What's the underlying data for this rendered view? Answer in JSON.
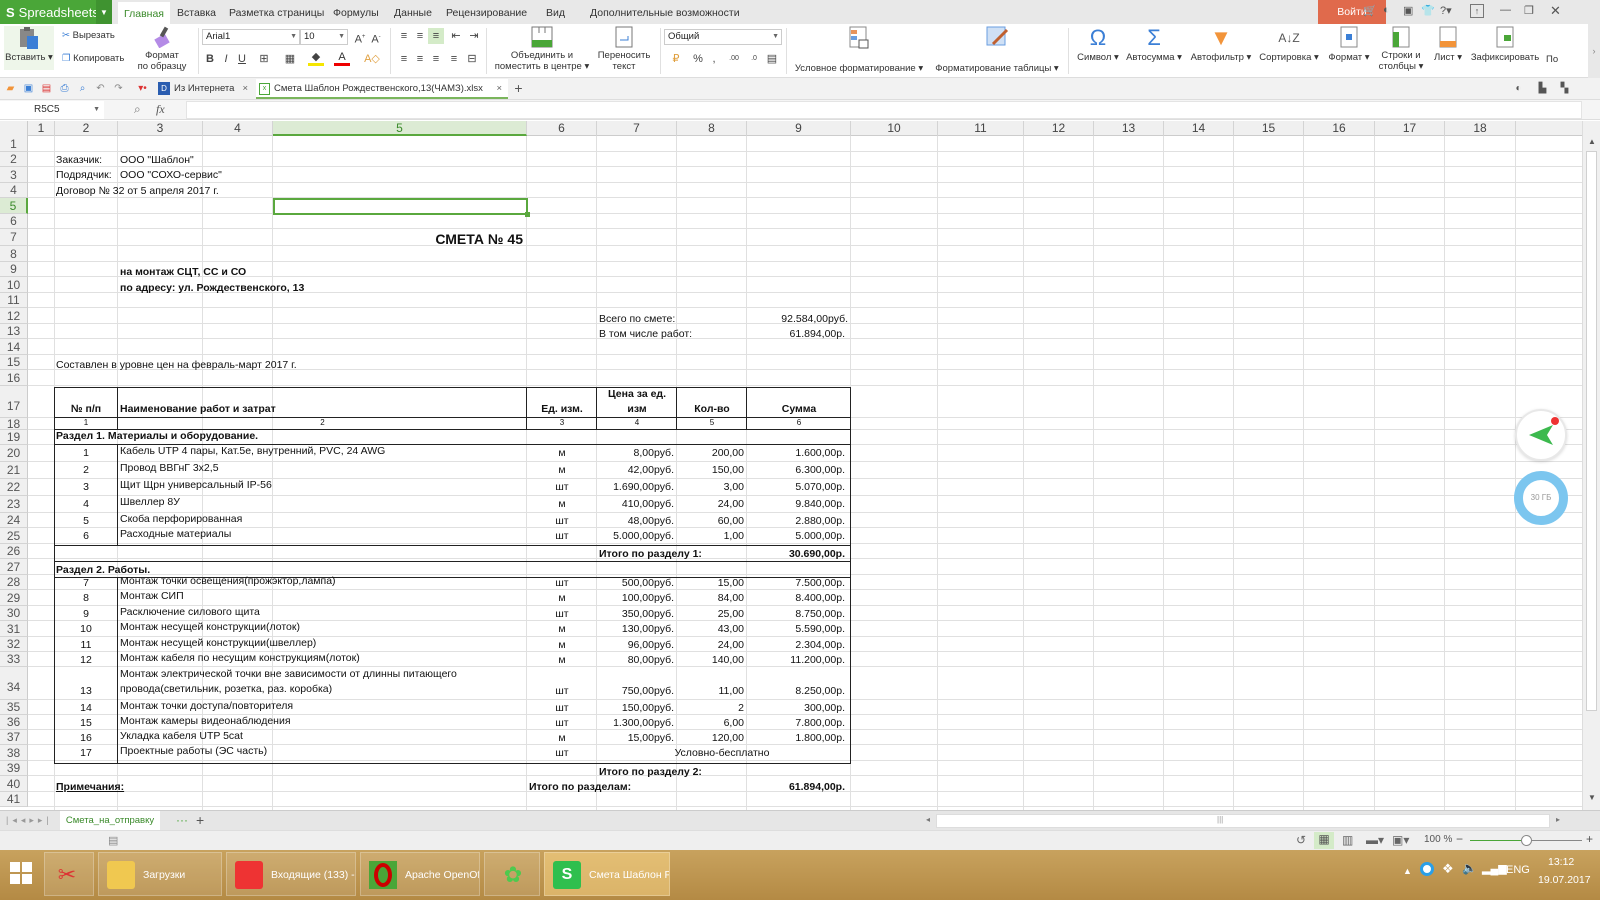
{
  "app": {
    "name": "Spreadsheets",
    "login_label": "Войти",
    "accent": "#4aa638",
    "login_color": "#e06a4c"
  },
  "menu_tabs": [
    "Главная",
    "Вставка",
    "Разметка страницы",
    "Формулы",
    "Данные",
    "Рецензирование",
    "Вид",
    "Дополнительные возможности"
  ],
  "ribbon": {
    "paste": "Вставить",
    "cut": "Вырезать",
    "copy": "Копировать",
    "format_painter_1": "Формат",
    "format_painter_2": "по образцу",
    "font_name": "Arial1",
    "font_size": "10",
    "merge_1": "Объединить и",
    "merge_2": "поместить в центре",
    "wrap_1": "Переносить",
    "wrap_2": "текст",
    "number_format": "Общий",
    "conditional": "Условное форматирование",
    "table_format": "Форматирование таблицы",
    "symbol": "Символ",
    "autosum": "Автосумма",
    "autofilter": "Автофильтр",
    "sort": "Сортировка",
    "format": "Формат",
    "rows_cols_1": "Строки и",
    "rows_cols_2": "столбцы",
    "sheet": "Лист",
    "freeze": "Зафиксировать",
    "more": "По"
  },
  "doc_tabs": [
    {
      "label": "Из Интернета",
      "active": false
    },
    {
      "label": "Смета Шаблон Рождественского,13(ЧАМЗ).xlsx",
      "active": true
    }
  ],
  "formula_bar": {
    "name_box": "R5C5",
    "fx": "fx",
    "value": ""
  },
  "columns": [
    "1",
    "2",
    "3",
    "4",
    "5",
    "6",
    "7",
    "8",
    "9",
    "10",
    "11",
    "12",
    "13",
    "14",
    "15",
    "16",
    "17",
    "18"
  ],
  "selected_column": "5",
  "selected_row": "5",
  "rows": [
    "1",
    "2",
    "3",
    "4",
    "5",
    "6",
    "7",
    "8",
    "9",
    "10",
    "11",
    "12",
    "13",
    "14",
    "15",
    "16",
    "17",
    "18",
    "19",
    "20",
    "21",
    "22",
    "23",
    "24",
    "25",
    "26",
    "27",
    "28",
    "29",
    "30",
    "31",
    "32",
    "33",
    "34",
    "35",
    "36",
    "37",
    "38",
    "39",
    "40",
    "41"
  ],
  "sheet": {
    "customer_label": "Заказчик:",
    "customer": "ООО \"Шаблон\"",
    "contractor_label": "Подрядчик:",
    "contractor": "ООО \"СОХО-сервис\"",
    "contract": "Договор № 32 от 5 апреля 2017 г.",
    "title": "СМЕТА № 45",
    "subtitle1": "на монтаж СЦТ, СС и СО",
    "subtitle2": "по адресу: ул. Рождественского, 13",
    "total_label": "Всего по смете:",
    "total_value": "92.584,00руб.",
    "works_label": "В том числе работ:",
    "works_value": "61.894,00р.",
    "prices_note": "Составлен в уровне цен на февраль-март 2017 г.",
    "headers": {
      "num": "№ п/п",
      "name": "Наименование работ и затрат",
      "unit": "Ед. изм.",
      "price_1": "Цена за ед.",
      "price_2": "изм",
      "qty": "Кол-во",
      "sum": "Сумма"
    },
    "header_numbers": [
      "1",
      "2",
      "3",
      "4",
      "5",
      "6"
    ],
    "section1_title": "Раздел 1. Материалы и оборудование.",
    "section1_items": [
      {
        "n": "1",
        "name": "Кабель UTP 4 пары, Кат.5е, внутренний, PVC, 24 AWG",
        "unit": "м",
        "price": "8,00руб.",
        "qty": "200,00",
        "sum": "1.600,00р."
      },
      {
        "n": "2",
        "name": "Провод ВВГнГ 3х2,5",
        "unit": "м",
        "price": "42,00руб.",
        "qty": "150,00",
        "sum": "6.300,00р."
      },
      {
        "n": "3",
        "name": "Щит Щрн универсальный IP-56",
        "unit": "шт",
        "price": "1.690,00руб.",
        "qty": "3,00",
        "sum": "5.070,00р."
      },
      {
        "n": "4",
        "name": "Швеллер 8У",
        "unit": "м",
        "price": "410,00руб.",
        "qty": "24,00",
        "sum": "9.840,00р."
      },
      {
        "n": "5",
        "name": "Скоба перфорированная",
        "unit": "шт",
        "price": "48,00руб.",
        "qty": "60,00",
        "sum": "2.880,00р."
      },
      {
        "n": "6",
        "name": "Расходные материалы",
        "unit": "шт",
        "price": "5.000,00руб.",
        "qty": "1,00",
        "sum": "5.000,00р."
      }
    ],
    "section1_total_label": "Итого по разделу 1:",
    "section1_total": "30.690,00р.",
    "section2_title": "Раздел 2. Работы.",
    "section2_items": [
      {
        "n": "7",
        "name": "Монтаж точки освещения(прожэктор,лампа)",
        "unit": "шт",
        "price": "500,00руб.",
        "qty": "15,00",
        "sum": "7.500,00р."
      },
      {
        "n": "8",
        "name": "Монтаж СИП",
        "unit": "м",
        "price": "100,00руб.",
        "qty": "84,00",
        "sum": "8.400,00р."
      },
      {
        "n": "9",
        "name": "Расключение силового щита",
        "unit": "шт",
        "price": "350,00руб.",
        "qty": "25,00",
        "sum": "8.750,00р."
      },
      {
        "n": "10",
        "name": "Монтаж несущей конструкции(лоток)",
        "unit": "м",
        "price": "130,00руб.",
        "qty": "43,00",
        "sum": "5.590,00р."
      },
      {
        "n": "11",
        "name": "Монтаж несущей конструкции(швеллер)",
        "unit": "м",
        "price": "96,00руб.",
        "qty": "24,00",
        "sum": "2.304,00р."
      },
      {
        "n": "12",
        "name": "Монтаж кабеля по несущим конструкциям(лоток)",
        "unit": "м",
        "price": "80,00руб.",
        "qty": "140,00",
        "sum": "11.200,00р."
      },
      {
        "n": "13",
        "name": "Монтаж электрической точки вне зависимости от длинны питающего",
        "name2": "провода(светильник, розетка, раз. коробка)",
        "unit": "шт",
        "price": "750,00руб.",
        "qty": "11,00",
        "sum": "8.250,00р."
      },
      {
        "n": "14",
        "name": "Монтаж точки доступа/повторителя",
        "unit": "шт",
        "price": "150,00руб.",
        "qty": "2",
        "sum": "300,00р."
      },
      {
        "n": "15",
        "name": "Монтаж камеры видеонаблюдения",
        "unit": "шт",
        "price": "1.300,00руб.",
        "qty": "6,00",
        "sum": "7.800,00р."
      },
      {
        "n": "16",
        "name": "Укладка кабеля UTP 5cat",
        "unit": "м",
        "price": "15,00руб.",
        "qty": "120,00",
        "sum": "1.800,00р."
      },
      {
        "n": "17",
        "name": "Проектные работы (ЭС часть)",
        "unit": "шт",
        "price_note": "Условно-бесплатно"
      }
    ],
    "section2_total_label": "Итого по разделу 2:",
    "notes_label": "Примечания:",
    "grand_total_label": "Итого по разделам:",
    "grand_total": "61.894,00р."
  },
  "sheet_tabs": [
    {
      "label": "Смета_на_отправку",
      "active": true
    }
  ],
  "status": {
    "zoom": "100 %",
    "zoom_fraction": 0.5
  },
  "floating": {
    "disk_label": "30 ГБ"
  },
  "taskbar": {
    "items": [
      {
        "label": "Загрузки"
      },
      {
        "label": "Входящие (133) - ..."
      },
      {
        "label": "Apache OpenOffi..."
      },
      {
        "label": "Смета Шаблон Р..."
      }
    ],
    "lang": "ENG",
    "time": "13:12",
    "date": "19.07.2017"
  }
}
